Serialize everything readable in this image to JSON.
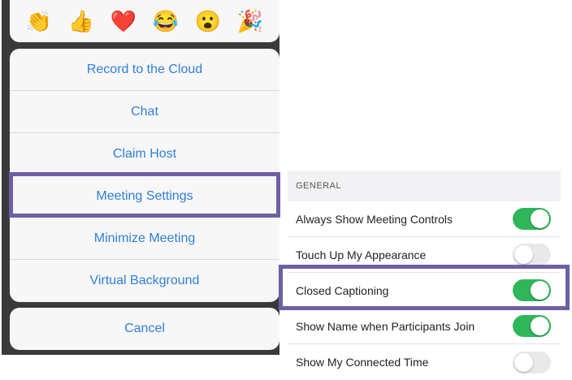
{
  "reactions": {
    "clap": "👏",
    "thumbs_up": "👍",
    "heart": "❤️",
    "joy": "😂",
    "open_mouth": "😮",
    "tada": "🎉"
  },
  "menu": {
    "items": [
      {
        "label": "Record to the Cloud"
      },
      {
        "label": "Chat"
      },
      {
        "label": "Claim Host"
      },
      {
        "label": "Meeting Settings"
      },
      {
        "label": "Minimize Meeting"
      },
      {
        "label": "Virtual Background"
      }
    ],
    "cancel_label": "Cancel"
  },
  "settings": {
    "section_header": "GENERAL",
    "rows": [
      {
        "label": "Always Show Meeting Controls",
        "on": true
      },
      {
        "label": "Touch Up My Appearance",
        "on": false
      },
      {
        "label": "Closed Captioning",
        "on": true
      },
      {
        "label": "Show Name when Participants Join",
        "on": true
      },
      {
        "label": "Show My Connected Time",
        "on": false
      }
    ]
  },
  "colors": {
    "accent_blue": "#2f7fd8",
    "toggle_on": "#2fb55a",
    "highlight": "#6f5fa3"
  }
}
